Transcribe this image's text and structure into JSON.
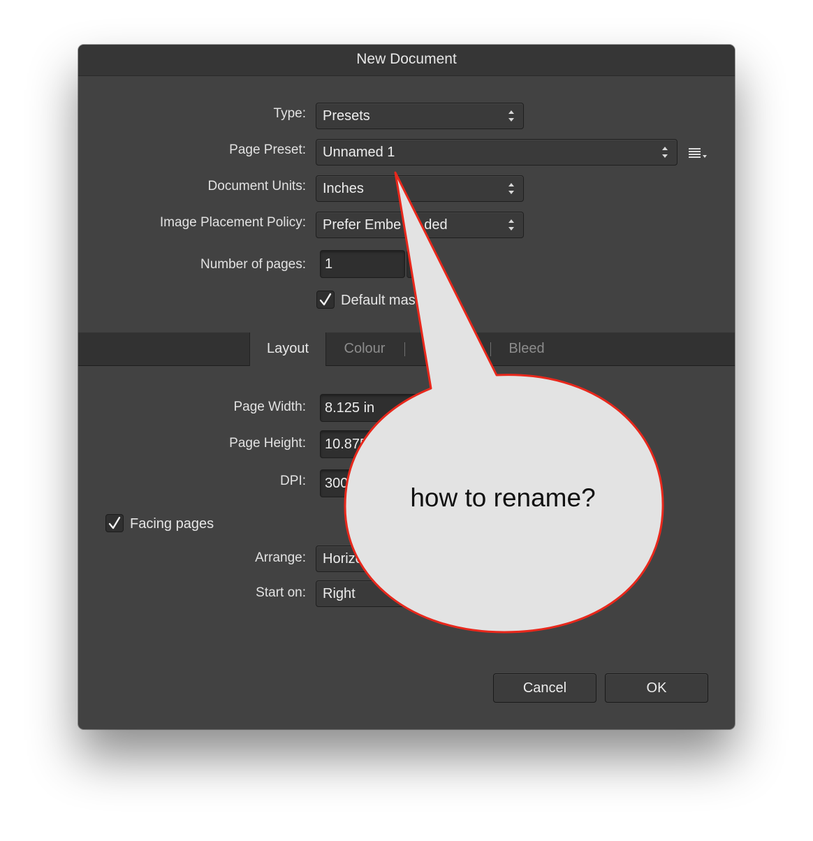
{
  "window": {
    "title": "New Document"
  },
  "form": {
    "type": {
      "label": "Type:",
      "value": "Presets"
    },
    "page_preset": {
      "label": "Page Preset:",
      "value": "Unnamed 1"
    },
    "document_units": {
      "label": "Document Units:",
      "value": "Inches"
    },
    "image_placement": {
      "label": "Image Placement Policy:",
      "value": "Prefer Embe",
      "value_tail": "ded"
    },
    "number_of_pages": {
      "label": "Number of pages:",
      "value": "1"
    },
    "default_master": {
      "label": "Default mas",
      "checked": true
    }
  },
  "tabs": [
    {
      "label": "Layout",
      "active": true
    },
    {
      "label": "Colour",
      "active": false
    },
    {
      "label": "",
      "active": false
    },
    {
      "label": "Bleed",
      "active": false
    }
  ],
  "layout": {
    "page_width": {
      "label": "Page Width:",
      "value": "8.125 in"
    },
    "page_height": {
      "label": "Page Height:",
      "value": "10.875"
    },
    "dpi": {
      "label": "DPI:",
      "value": "300"
    },
    "facing_pages": {
      "label": "Facing pages",
      "checked": true
    },
    "arrange": {
      "label": "Arrange:",
      "value": "Horizo"
    },
    "start_on": {
      "label": "Start on:",
      "value": "Right"
    }
  },
  "buttons": {
    "cancel": "Cancel",
    "ok": "OK"
  },
  "annotation": {
    "text": "how to rename?",
    "fill": "#e3e3e3",
    "stroke": "#e8281c"
  },
  "colors": {
    "dialog_bg": "#424242",
    "titlebar_bg": "#363636",
    "text": "#e2e2e2"
  }
}
